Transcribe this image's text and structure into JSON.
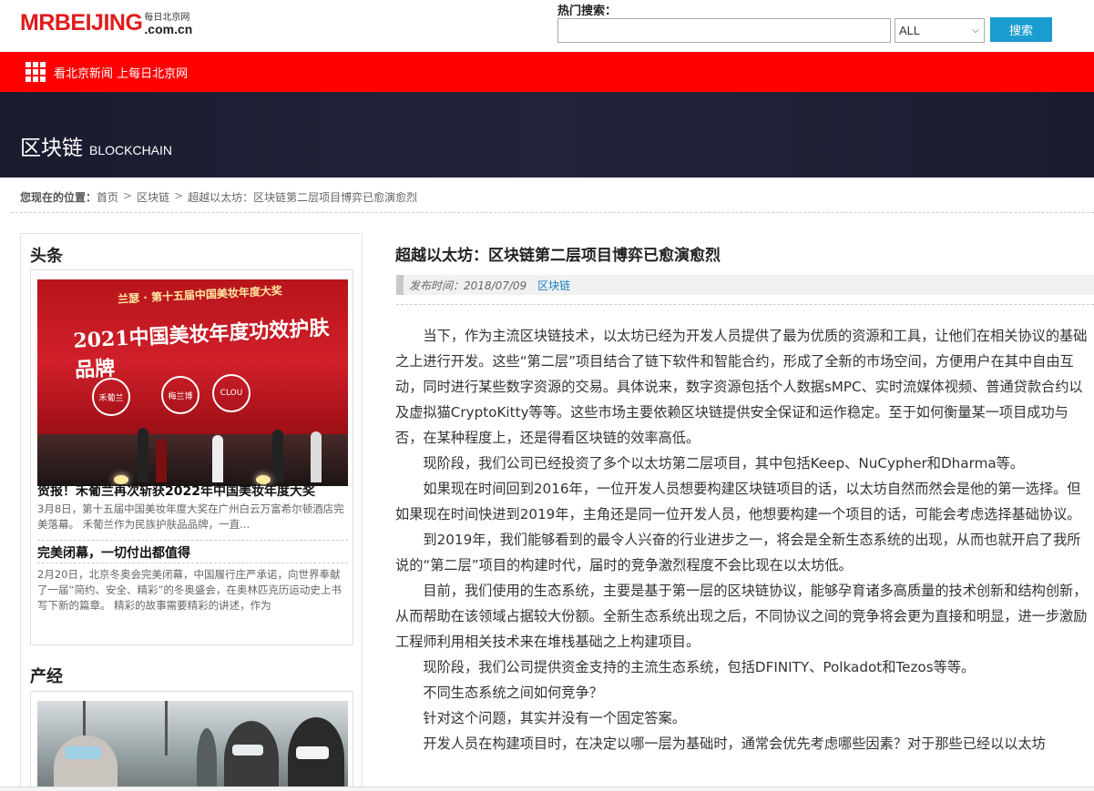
{
  "header": {
    "logo_main": "MRBEIJING",
    "logo_cn": "每日北京网",
    "logo_domain": ".com.cn",
    "search_label": "热门搜索：",
    "search_value": "",
    "search_scope": "ALL",
    "search_button": "搜索"
  },
  "nav": {
    "text": "看北京新闻 上每日北京网"
  },
  "banner": {
    "title_cn": "区块链",
    "title_en": "BLOCKCHAIN"
  },
  "breadcrumb": {
    "lead": "您现在的位置：",
    "items": [
      "首页",
      "区块链",
      "超越以太坊：区块链第二层项目博弈已愈演愈烈"
    ],
    "sep": ">"
  },
  "sidebar": {
    "headline_title": "头条",
    "headline_items": [
      {
        "title": "贺报！禾葡兰再次斩获2022年中国美妆年度大奖",
        "desc": "3月8日，第十五届中国美妆年度大奖在广州白云万富希尔顿酒店完美落幕。 禾葡兰作为民族护肤品品牌，一直..."
      },
      {
        "title": "完美闭幕，一切付出都值得",
        "desc": "2月20日，北京冬奥会完美闭幕，中国履行庄严承诺，向世界奉献了一届“简约、安全、精彩”的冬奥盛会，在奥林匹克历运动史上书写下新的篇章。 精彩的故事需要精彩的讲述，作为"
      }
    ],
    "photo1_texts": {
      "top": "兰瑟 · 第十五届中国美妆年度大奖",
      "main": "2021中国美妆年度功效护肤品牌",
      "badge1": "禾葡兰",
      "badge2": "梅兰博",
      "badge3": "CLOU"
    },
    "industry_title": "产经"
  },
  "article": {
    "title": "超越以太坊：区块链第二层项目博弈已愈演愈烈",
    "time": "发布时间：2018/07/09",
    "tag": "区块链",
    "paragraphs": [
      "当下，作为主流区块链技术，以太坊已经为开发人员提供了最为优质的资源和工具，让他们在相关协议的基础之上进行开发。这些“第二层”项目结合了链下软件和智能合约，形成了全新的市场空间，方便用户在其中自由互动，同时进行某些数字资源的交易。具体说来，数字资源包括个人数据sMPC、实时流媒体视频、普通贷款合约以及虚拟猫CryptoKitty等等。这些市场主要依赖区块链提供安全保证和运作稳定。至于如何衡量某一项目成功与否，在某种程度上，还是得看区块链的效率高低。",
      "现阶段，我们公司已经投资了多个以太坊第二层项目，其中包括Keep、NuCypher和Dharma等。",
      "如果现在时间回到2016年，一位开发人员想要构建区块链项目的话，以太坊自然而然会是他的第一选择。但如果现在时间快进到2019年，主角还是同一位开发人员，他想要构建一个项目的话，可能会考虑选择基础协议。",
      "到2019年，我们能够看到的最令人兴奋的行业进步之一，将会是全新生态系统的出现，从而也就开启了我所说的“第二层”项目的构建时代，届时的竞争激烈程度不会比现在以太坊低。",
      "目前，我们使用的生态系统，主要是基于第一层的区块链协议，能够孕育诸多高质量的技术创新和结构创新，从而帮助在该领域占据较大份额。全新生态系统出现之后，不同协议之间的竞争将会更为直接和明显，进一步激励工程师利用相关技术来在堆栈基础之上构建项目。",
      "现阶段，我们公司提供资金支持的主流生态系统，包括DFINITY、Polkadot和Tezos等等。",
      "不同生态系统之间如何竞争？",
      "针对这个问题，其实并没有一个固定答案。",
      "开发人员在构建项目时，在决定以哪一层为基础时，通常会优先考虑哪些因素？对于那些已经以以太坊"
    ]
  }
}
